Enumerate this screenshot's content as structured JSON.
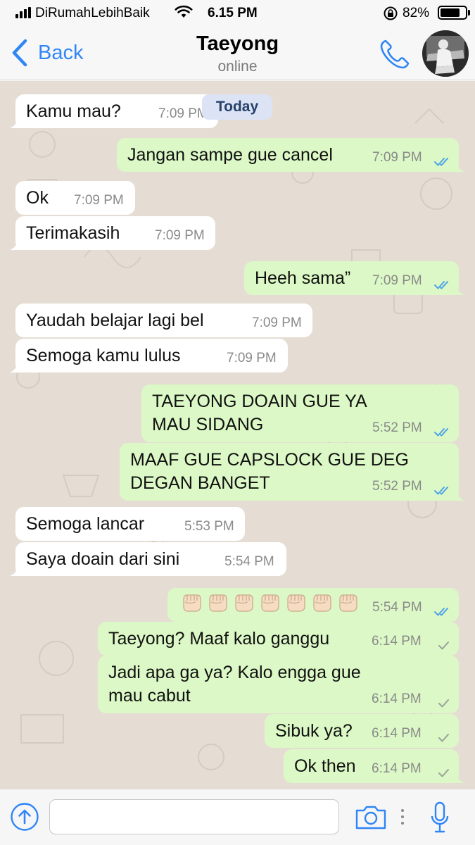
{
  "status_bar": {
    "carrier": "DiRumahLebihBaik",
    "time": "6.15 PM",
    "battery": "82%",
    "battery_level": 0.82,
    "icons": [
      "signal-icon",
      "wifi-icon",
      "orientation-lock-icon",
      "battery-icon"
    ]
  },
  "header": {
    "back_label": "Back",
    "contact_name": "Taeyong",
    "contact_status": "online",
    "icons": [
      "chevron-left-icon",
      "phone-icon",
      "avatar"
    ]
  },
  "chat": {
    "date_label": "Today",
    "messages": [
      {
        "dir": "in",
        "text": "Kamu mau?",
        "time": "7:09 PM"
      },
      {
        "dir": "out",
        "text": "Jangan sampe gue cancel",
        "time": "7:09 PM",
        "status": "read"
      },
      {
        "dir": "in",
        "text": "Ok",
        "time": "7:09 PM"
      },
      {
        "dir": "in",
        "text": "Terimakasih",
        "time": "7:09 PM"
      },
      {
        "dir": "out",
        "text": "Heeh sama”",
        "time": "7:09 PM",
        "status": "read"
      },
      {
        "dir": "in",
        "text": "Yaudah belajar lagi bel",
        "time": "7:09 PM"
      },
      {
        "dir": "in",
        "text": "Semoga kamu lulus",
        "time": "7:09 PM"
      },
      {
        "dir": "out",
        "lines": [
          "TAEYONG DOAIN GUE YA",
          "MAU SIDANG"
        ],
        "time": "5:52 PM",
        "status": "read"
      },
      {
        "dir": "out",
        "lines": [
          "MAAF GUE CAPSLOCK GUE DEG",
          "DEGAN BANGET"
        ],
        "time": "5:52 PM",
        "status": "read"
      },
      {
        "dir": "in",
        "text": "Semoga lancar",
        "time": "5:53 PM"
      },
      {
        "dir": "in",
        "text": "Saya doain dari sini",
        "time": "5:54 PM"
      },
      {
        "dir": "out",
        "emoji": "raised-fist-emoji",
        "emoji_count": 7,
        "time": "5:54 PM",
        "status": "read"
      },
      {
        "dir": "out",
        "text": "Taeyong? Maaf kalo ganggu",
        "time": "6:14 PM",
        "status": "sent"
      },
      {
        "dir": "out",
        "lines": [
          "Jadi apa ga ya? Kalo engga gue",
          "mau cabut"
        ],
        "time": "6:14 PM",
        "status": "sent"
      },
      {
        "dir": "out",
        "text": "Sibuk ya?",
        "time": "6:14 PM",
        "status": "sent"
      },
      {
        "dir": "out",
        "text": "Ok then",
        "time": "6:14 PM",
        "status": "sent"
      }
    ]
  },
  "input_bar": {
    "placeholder": "",
    "icons": [
      "arrow-up-circle-icon",
      "camera-icon",
      "more-dots-icon",
      "microphone-icon"
    ]
  },
  "colors": {
    "accent": "#2f86f6",
    "incoming_bubble": "#ffffff",
    "outgoing_bubble": "#dcf8c6",
    "chat_background": "#e5ddd3",
    "read_ticks": "#4fa3e8",
    "sent_tick": "#9aa39a"
  }
}
